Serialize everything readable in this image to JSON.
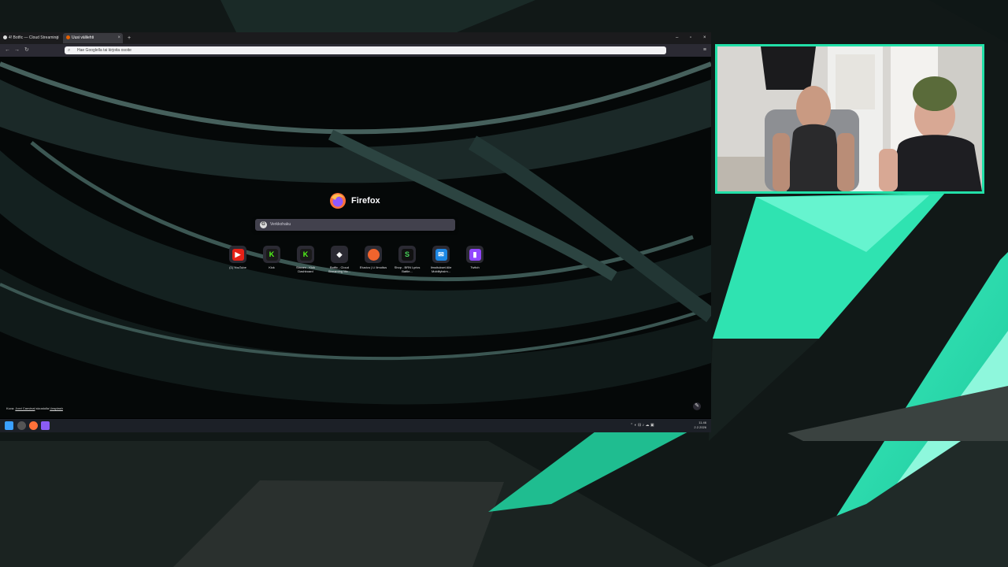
{
  "browser": {
    "tabs": [
      {
        "label": "4! Botfic — Cloud Streaming",
        "favicon_color": "#2b2a33"
      },
      {
        "label": "Uusi välilehti",
        "favicon_color": "#e66000"
      }
    ],
    "url": "Hae Googlella tai kirjoita osoite",
    "new_tab_symbol": "+",
    "menu_symbol": "≡"
  },
  "new_tab_page": {
    "brand": "Firefox",
    "search_placeholder": "Verkkohaku",
    "shortcuts": [
      {
        "label": "(1) YouTube",
        "icon": "youtube-icon",
        "color": "#e62117",
        "glyph": "▶"
      },
      {
        "label": "Kick",
        "icon": "kick-icon",
        "color": "#53fc18",
        "glyph": "K"
      },
      {
        "label": "Stream - Kick Dashboard",
        "icon": "kick-icon",
        "color": "#53fc18",
        "glyph": "K"
      },
      {
        "label": "Botfic - Cloud Streaming Mo...",
        "icon": "botfic-icon",
        "color": "#ffffff",
        "glyph": "◆"
      },
      {
        "label": "Etusivu | Li Ilmoitus",
        "icon": "orange-circle-icon",
        "color": "#f0642d",
        "glyph": "●"
      },
      {
        "label": "Shop - BRN Lyrics Battle...",
        "icon": "s-icon",
        "color": "#2d8c3c",
        "glyph": "S"
      },
      {
        "label": "Ilmoitukset Alle Mobiliyksim...",
        "icon": "mail-icon",
        "color": "#1e88e5",
        "glyph": "✉"
      },
      {
        "label": "Twitch",
        "icon": "twitch-icon",
        "color": "#9146ff",
        "glyph": "▮"
      }
    ],
    "credit": {
      "prefix": "Kuva:",
      "author": "Jorvi Canvinal",
      "middle": "sivustolla",
      "source": "Unsplash"
    }
  },
  "taskbar": {
    "icons": [
      {
        "name": "start-icon",
        "color": "#3aa0ff"
      },
      {
        "name": "settings-icon",
        "color": "#888888"
      },
      {
        "name": "firefox-icon",
        "color": "#ff7139"
      },
      {
        "name": "app-icon",
        "color": "#8a5cf5"
      }
    ],
    "tray": "⌃ ◐ ⊟ ♪ ☁ ▣",
    "time": "11.46",
    "date": "2.2.2026"
  },
  "colors": {
    "accent": "#22e0a8",
    "background": "#0e1413"
  }
}
